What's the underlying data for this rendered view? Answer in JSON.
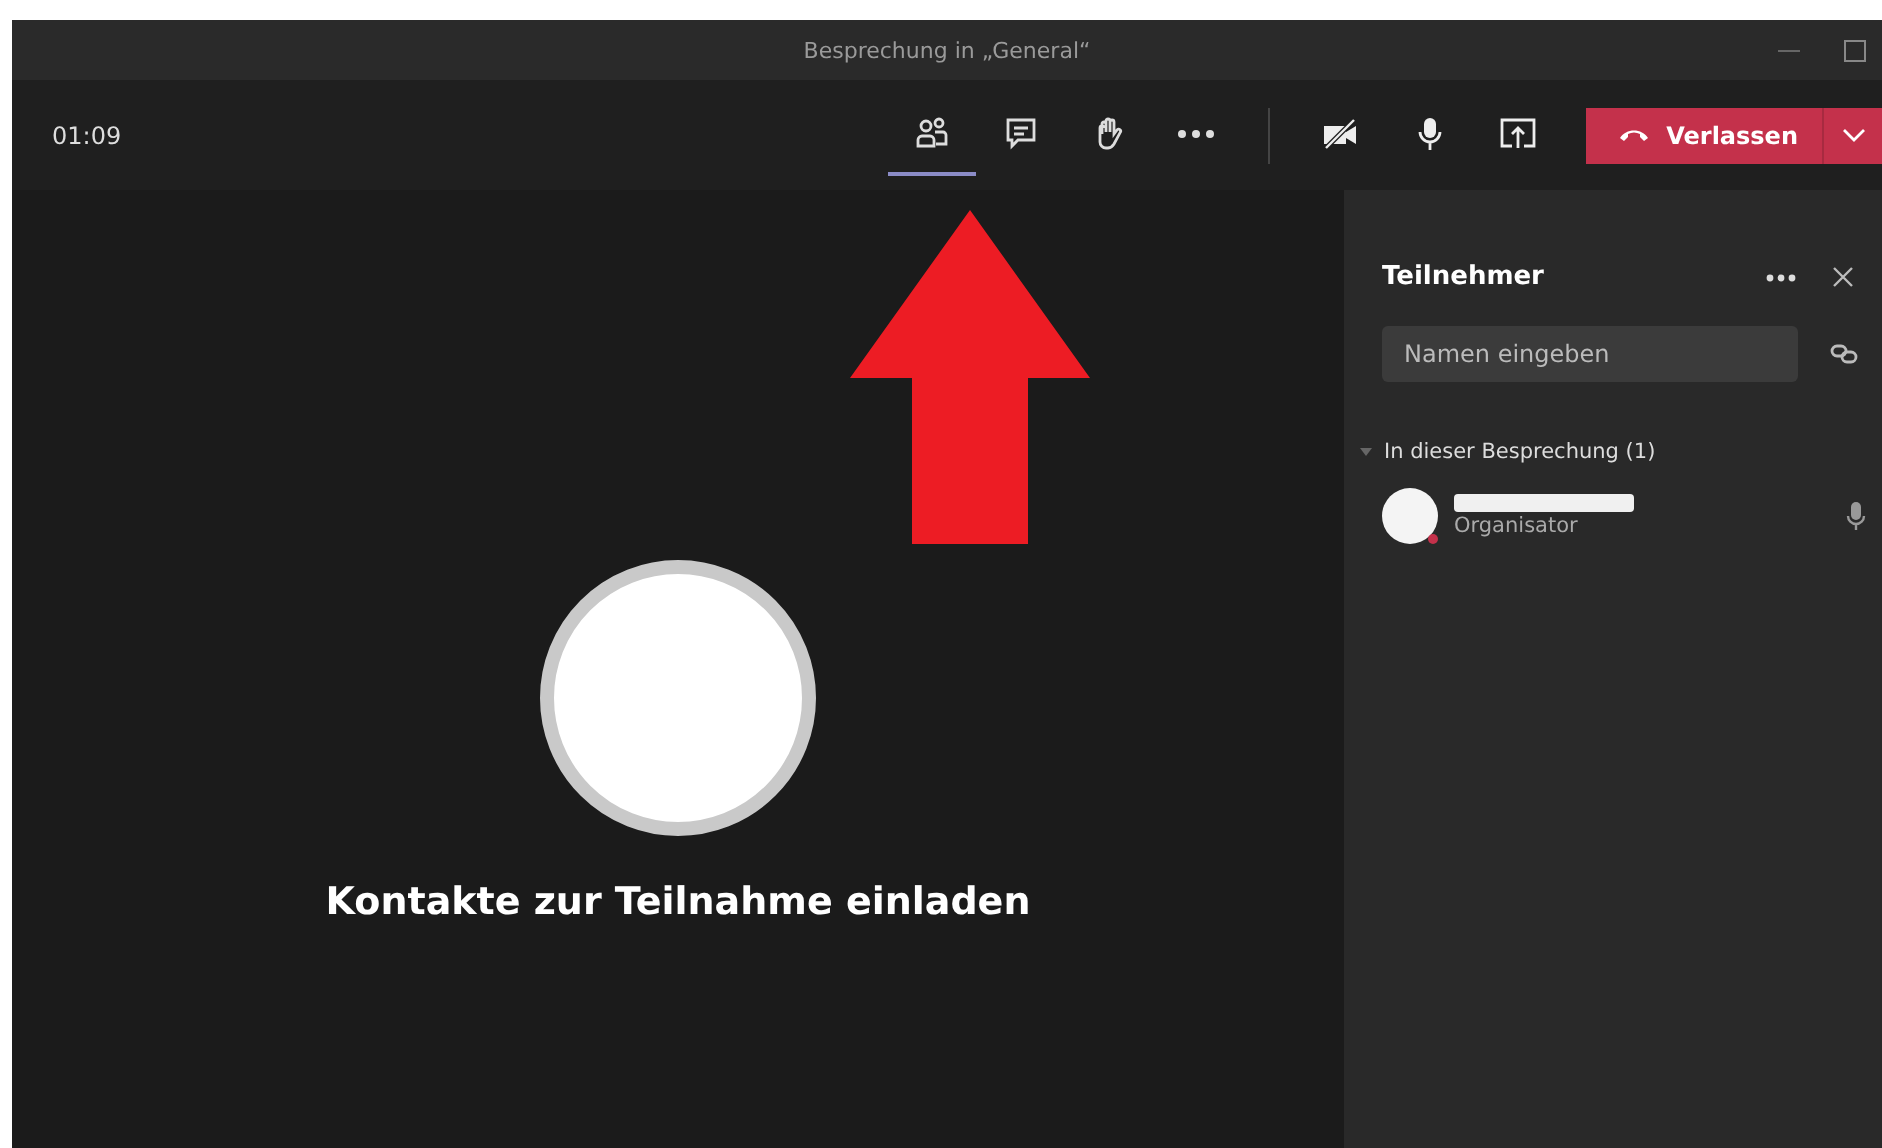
{
  "window": {
    "title": "Besprechung in „General“"
  },
  "toolbar": {
    "timer": "01:09",
    "buttons": [
      {
        "kind": "people",
        "selected": true
      },
      {
        "kind": "chat",
        "selected": false
      },
      {
        "kind": "hand",
        "selected": false
      },
      {
        "kind": "more",
        "selected": false
      }
    ],
    "leave_button": {
      "label": "Verlassen"
    }
  },
  "stage": {
    "invite_text": "Kontakte zur Teilnahme einladen"
  },
  "panel": {
    "title": "Teilnehmer",
    "search": {
      "placeholder": "Namen eingeben"
    },
    "section": {
      "label": "In dieser Besprechung (1)",
      "expanded": true
    },
    "participants": [
      {
        "role": "Organisator"
      }
    ]
  }
}
